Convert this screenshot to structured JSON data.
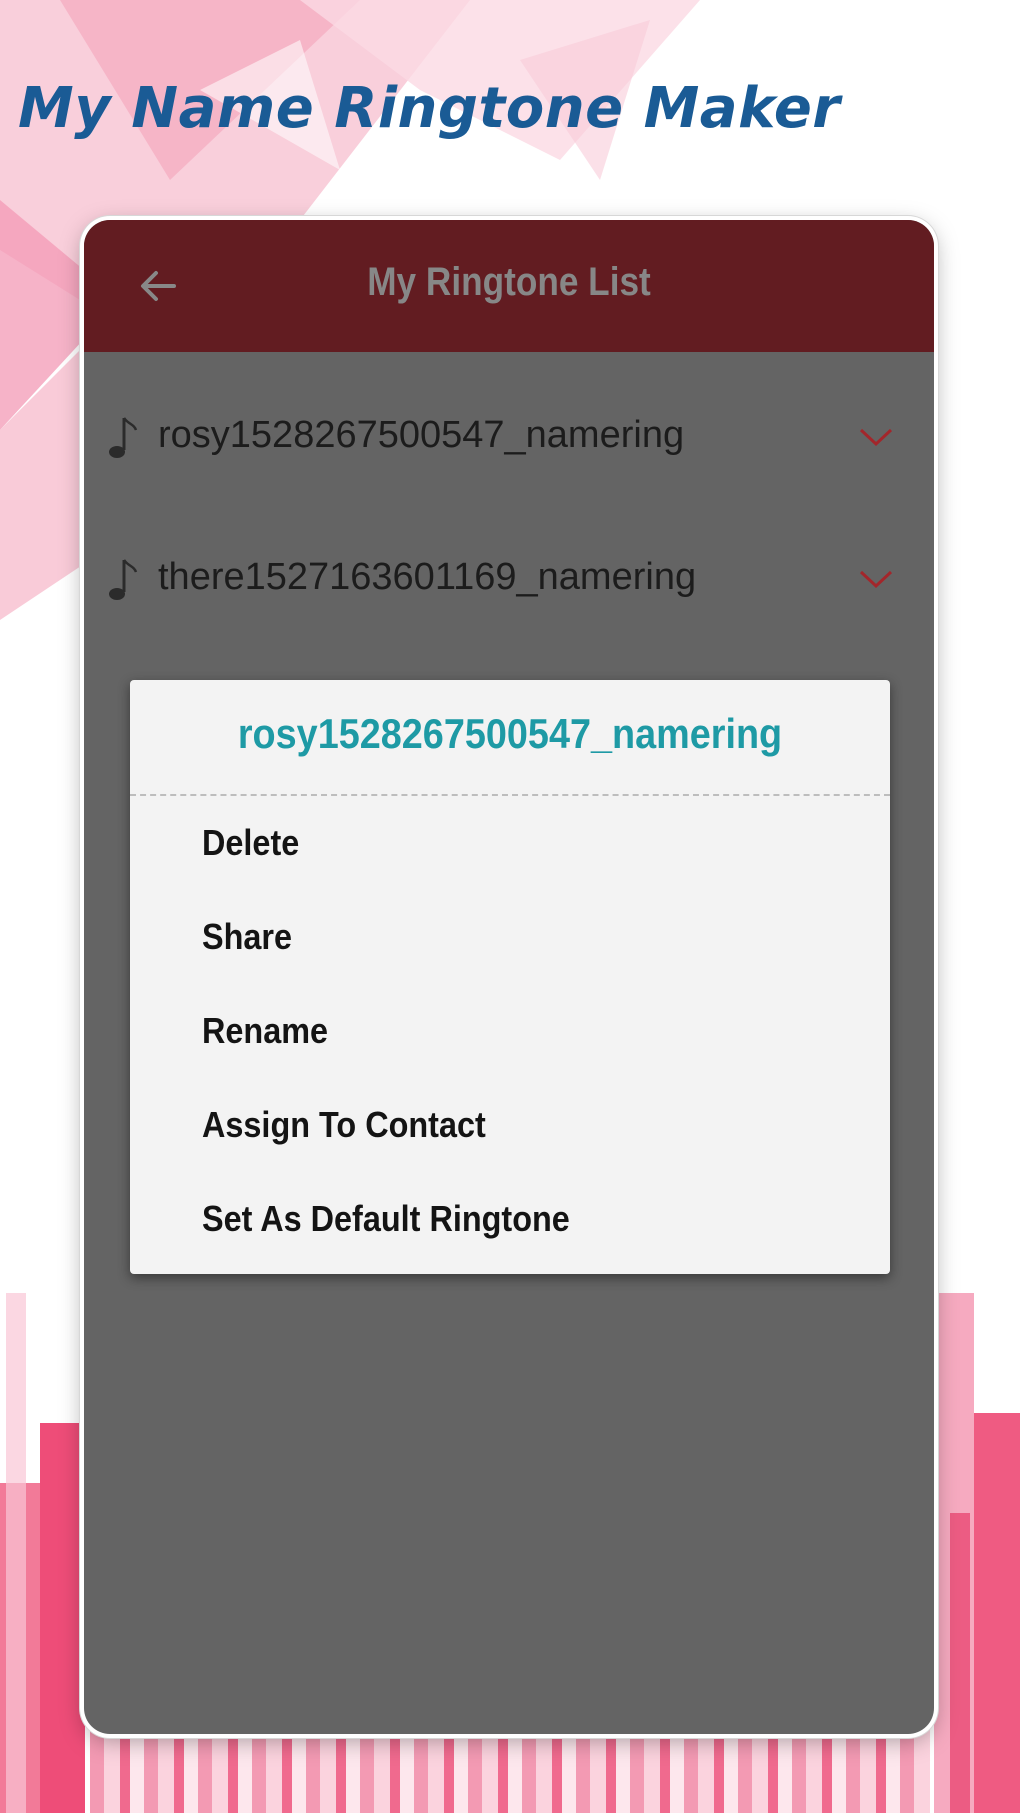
{
  "promo": {
    "title": "My Name Ringtone Maker"
  },
  "app_bar": {
    "title": "My Ringtone List",
    "back_icon": "arrow-left-icon"
  },
  "ringtones": [
    {
      "name": "rosy1528267500547_namering",
      "icon": "music-note-icon",
      "action_icon": "chevron-down-icon"
    },
    {
      "name": "there1527163601169_namering",
      "icon": "music-note-icon",
      "action_icon": "chevron-down-icon"
    }
  ],
  "dialog": {
    "title": "rosy1528267500547_namering",
    "options": [
      "Delete",
      "Share",
      "Rename",
      "Assign To Contact",
      "Set As Default Ringtone"
    ]
  },
  "colors": {
    "title_blue": "#1a5b95",
    "app_bar": "#621c21",
    "chevron": "#a3262b",
    "dialog_title": "#1e9aa5",
    "overlay": "#646464"
  }
}
